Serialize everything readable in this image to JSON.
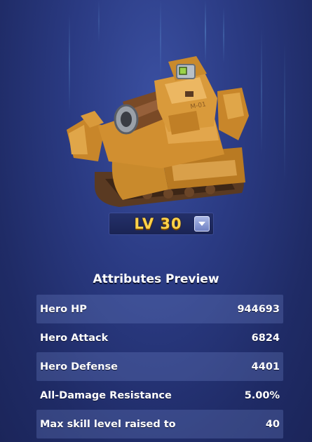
{
  "hero": {
    "level_label": "LV 30"
  },
  "attributes": {
    "title": "Attributes Preview",
    "rows": [
      {
        "name": "Hero HP",
        "value": "944693"
      },
      {
        "name": "Hero Attack",
        "value": "6824"
      },
      {
        "name": "Hero Defense",
        "value": "4401"
      },
      {
        "name": "All-Damage Resistance",
        "value": "5.00%"
      },
      {
        "name": "Max skill level raised to",
        "value": "40"
      }
    ]
  },
  "colors": {
    "background": "#2a3a82",
    "level_text": "#ffd24a",
    "row_shade": "#4a5aa8",
    "tank_body": "#d8952e"
  },
  "icons": {
    "level_dropdown": "chevron-down-icon",
    "hero_image": "orange-tank-mech"
  }
}
